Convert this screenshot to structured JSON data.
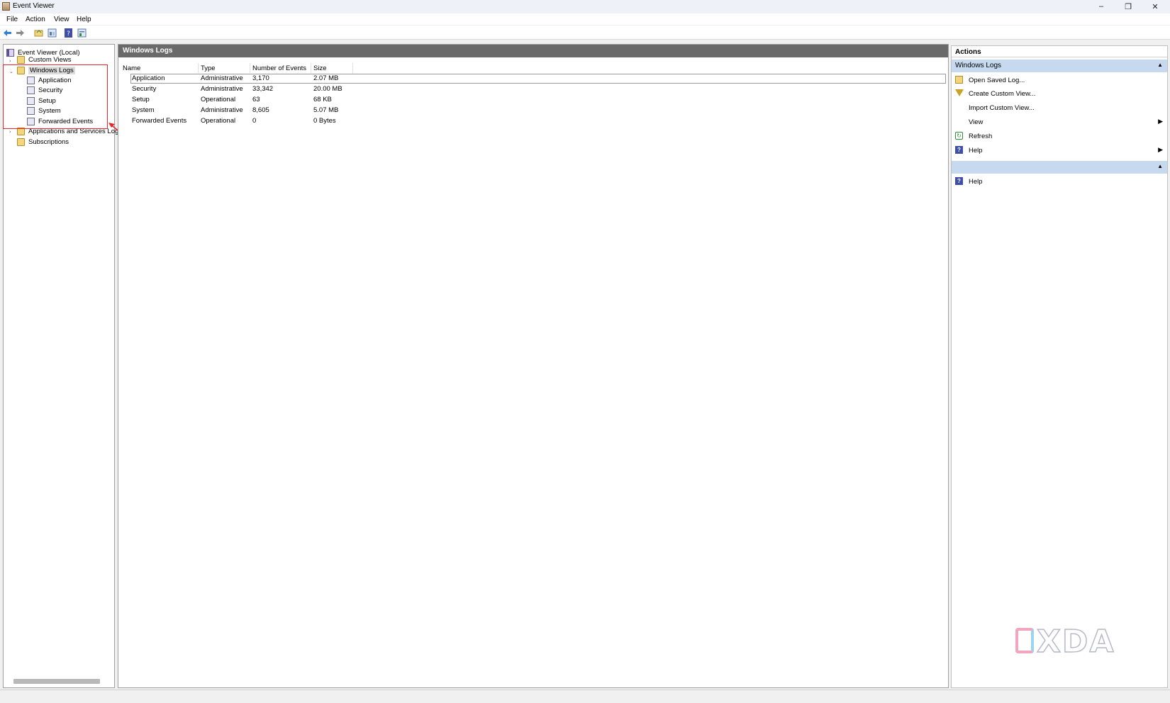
{
  "window": {
    "title": "Event Viewer",
    "controls": [
      "–",
      "❐",
      "✕"
    ]
  },
  "menu": [
    "File",
    "Action",
    "View",
    "Help"
  ],
  "toolbar": {
    "icons": [
      "back-arrow-icon",
      "forward-arrow-icon",
      "open-folder-icon",
      "show-hide-tree-icon",
      "help-icon",
      "properties-icon"
    ]
  },
  "tree": {
    "root": "Event Viewer (Local)",
    "custom_views": "Custom Views",
    "windows_logs": "Windows Logs",
    "children": [
      "Application",
      "Security",
      "Setup",
      "System",
      "Forwarded Events"
    ],
    "apps_services": "Applications and Services Log",
    "subscriptions": "Subscriptions"
  },
  "center": {
    "header": "Windows Logs",
    "columns": [
      "Name",
      "Type",
      "Number of Events",
      "Size"
    ],
    "rows": [
      [
        "Application",
        "Administrative",
        "3,170",
        "2.07 MB"
      ],
      [
        "Security",
        "Administrative",
        "33,342",
        "20.00 MB"
      ],
      [
        "Setup",
        "Operational",
        "63",
        "68 KB"
      ],
      [
        "System",
        "Administrative",
        "8,605",
        "5.07 MB"
      ],
      [
        "Forwarded Events",
        "Operational",
        "0",
        "0 Bytes"
      ]
    ]
  },
  "actions": {
    "title": "Actions",
    "section1": "Windows Logs",
    "items": [
      "Open Saved Log...",
      "Create Custom View...",
      "Import Custom View...",
      "View",
      "Refresh",
      "Help"
    ],
    "section2": "",
    "items2": [
      "Help"
    ]
  },
  "watermark": "XDA",
  "colors": {
    "annotation": "#e8262a",
    "panel_header": "#6a6a6a",
    "action_header": "#c6d9ee"
  }
}
